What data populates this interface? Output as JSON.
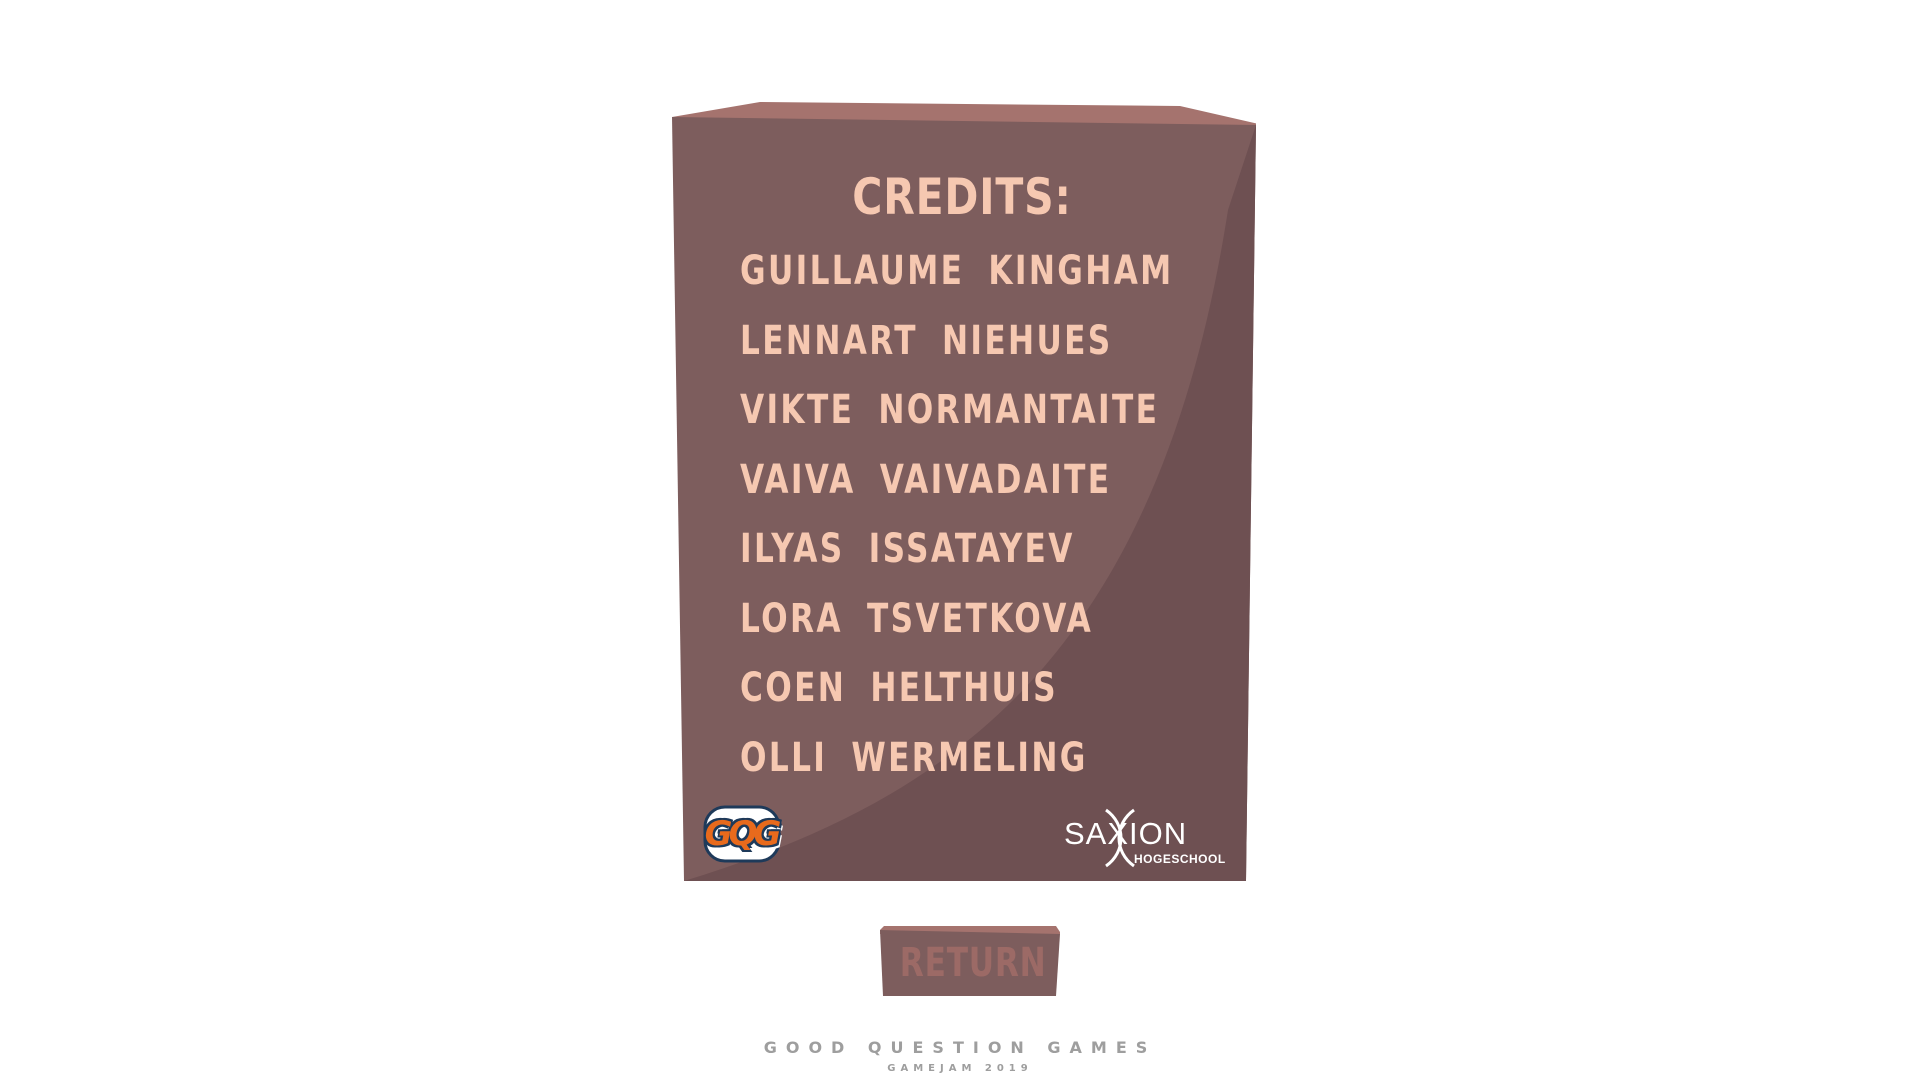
{
  "credits": {
    "title": "CREDITS:",
    "names": [
      "GUILLAUME KINGHAM",
      "LENNART NIEHUES",
      "VIKTE NORMANTAITE",
      "VAIVA VAIVADAITE",
      "ILYAS ISSATAYEV",
      "LORA TSVETKOVA",
      "COEN HELTHUIS",
      "OLLI WERMELING"
    ],
    "logos": {
      "gqg_text": "GQG",
      "saxion_name": "SAXION",
      "saxion_sub": "HOGESCHOOL"
    }
  },
  "return_button": {
    "label": "RETURN"
  },
  "footer": {
    "brand": "GOOD QUESTION GAMES",
    "sub": "GAMEJAM 2019"
  },
  "colors": {
    "box_front": "#7d5d5d",
    "box_top": "#a5736e",
    "box_shadow": "#6e5052",
    "text": "#f6c8b1",
    "button_label": "#9c6a66",
    "footer_text": "#9e9e9e"
  }
}
